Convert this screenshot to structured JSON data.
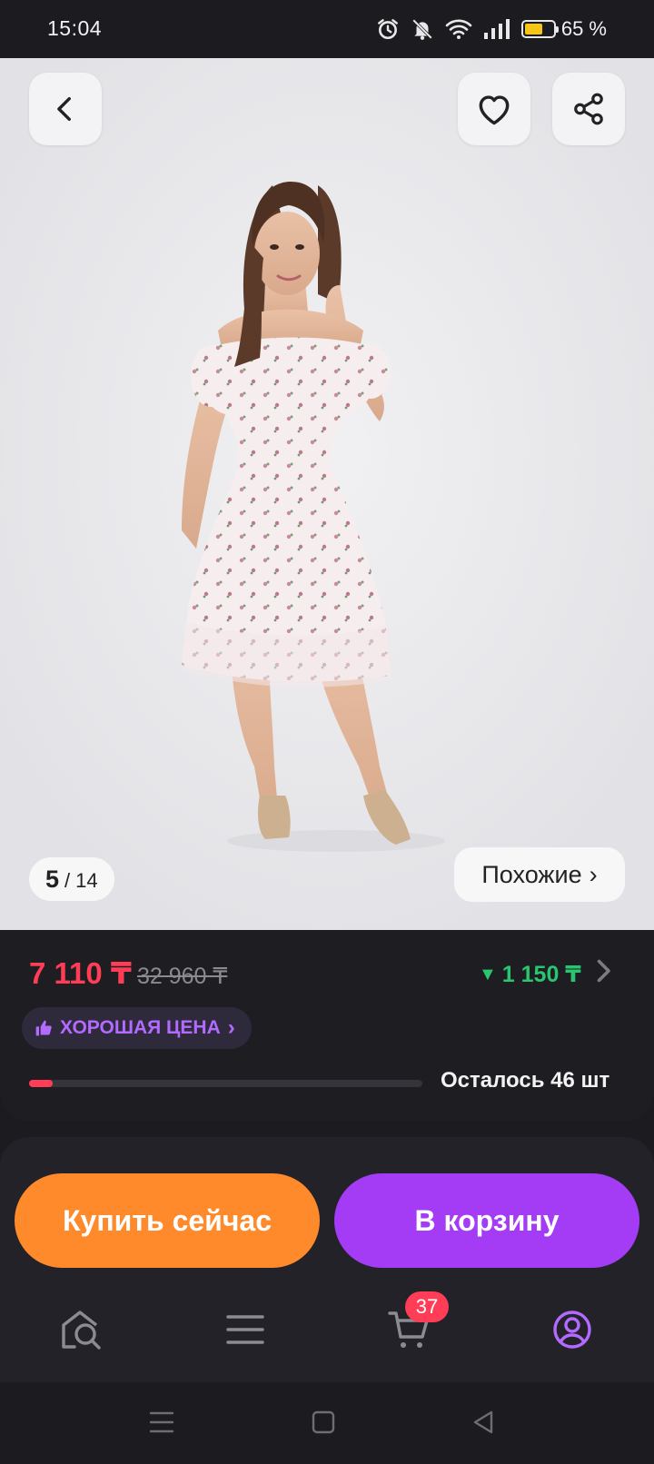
{
  "status_bar": {
    "time": "15:04",
    "battery_percent": "65 %",
    "battery_level": 0.65,
    "icons": [
      "alarm-icon",
      "mute-icon",
      "wifi-icon",
      "signal-icon",
      "battery-icon"
    ]
  },
  "gallery": {
    "counter_current": "5",
    "counter_separator": "/",
    "counter_total": "14",
    "similar_label": "Похожие",
    "similar_chevron": "›"
  },
  "price": {
    "current": "7 110 ₸",
    "old": "32 960 ₸",
    "drop_arrow": "▼",
    "drop_amount": "1 150 ₸",
    "good_price_label": "ХОРОШАЯ ЦЕНА",
    "good_price_chevron": "›",
    "stock_text": "Осталось 46 шт",
    "stock_fraction": 0.06
  },
  "actions": {
    "buy_now": "Купить сейчас",
    "add_to_cart": "В корзину"
  },
  "tab_bar": {
    "cart_badge": "37"
  },
  "colors": {
    "accent_purple": "#a43cf5",
    "accent_orange": "#ff8a2b",
    "price_red": "#ff3d57",
    "drop_green": "#28c76f"
  }
}
